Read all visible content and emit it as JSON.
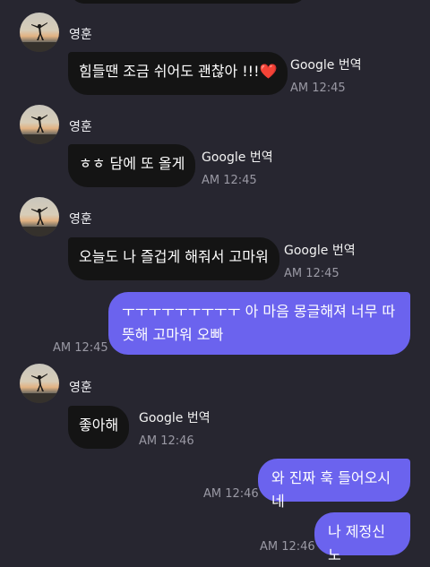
{
  "sender_name": "영훈",
  "translate_label": "Google 번역",
  "messages": [
    {
      "text": "힘들땐 조금 쉬어도 괜찮아 !!!",
      "time": "AM 12:45",
      "emoji": "❤️"
    },
    {
      "text": "ㅎㅎ 담에 또 올게",
      "time": "AM 12:45"
    },
    {
      "text": "오늘도 나 즐겁게 해줘서 고마워",
      "time": "AM 12:45"
    },
    {
      "text": "ㅜㅜㅜㅜㅜㅜㅜㅜㅜ 아 마음 몽글해져 너무 따뜻해 고마워 오빠",
      "time": "AM 12:45"
    },
    {
      "text": "좋아해",
      "time": "AM 12:46"
    },
    {
      "text": "와 진짜 훅 들어오시네",
      "time": "AM 12:46"
    },
    {
      "text": "나 제정신 노",
      "time": "AM 12:46"
    }
  ],
  "colors": {
    "background": "#272630",
    "incoming_bubble": "#141414",
    "outgoing_bubble": "#6b63ee",
    "heart": "#e0282e"
  }
}
